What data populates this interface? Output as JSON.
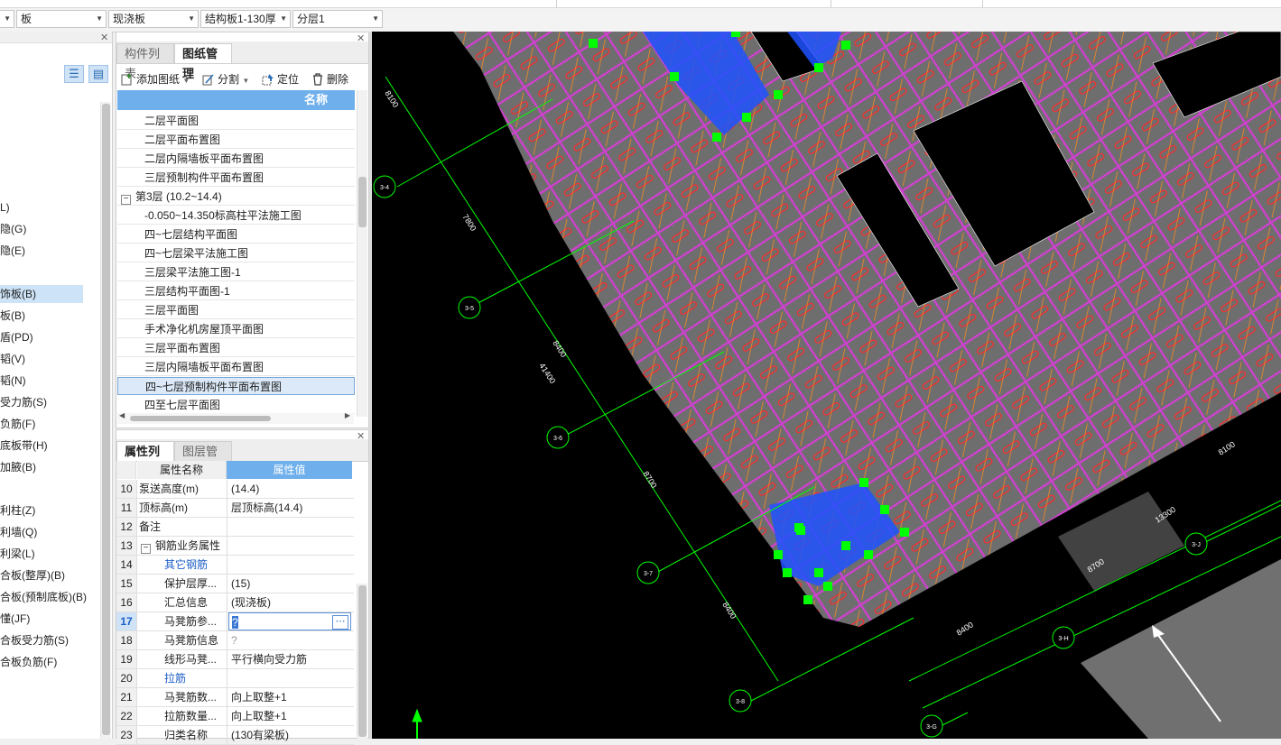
{
  "toolbar": {
    "combo_board": "板",
    "combo_type": "现浇板",
    "combo_spec": "结构板1-130厚",
    "combo_floor": "分层1"
  },
  "nav": {
    "items": [
      {
        "label": "L)"
      },
      {
        "label": "隐(G)"
      },
      {
        "label": "隐(E)"
      },
      {
        "label": "饰板(B)",
        "selected": true
      },
      {
        "label": "板(B)"
      },
      {
        "label": "盾(PD)"
      },
      {
        "label": "韬(V)"
      },
      {
        "label": "韬(N)"
      },
      {
        "label": "受力筋(S)"
      },
      {
        "label": "负筋(F)"
      },
      {
        "label": "底板带(H)"
      },
      {
        "label": "加腋(B)"
      },
      {
        "label": "利柱(Z)"
      },
      {
        "label": "利墙(Q)"
      },
      {
        "label": "利梁(L)"
      },
      {
        "label": "合板(整厚)(B)"
      },
      {
        "label": "合板(预制底板)(B)"
      },
      {
        "label": "懂(JF)"
      },
      {
        "label": "合板受力筋(S)"
      },
      {
        "label": "合板负筋(F)"
      }
    ]
  },
  "drawing_panel": {
    "tab_component_list": "构件列表",
    "tab_drawing_mgmt": "图纸管理",
    "btn_add": "添加图纸",
    "btn_split": "分割",
    "btn_locate": "定位",
    "btn_delete": "删除",
    "col_name": "名称",
    "rows": [
      {
        "label": "二层平面图",
        "indent": true
      },
      {
        "label": "二层平面布置图",
        "indent": true
      },
      {
        "label": "二层内隔墙板平面布置图",
        "indent": true
      },
      {
        "label": "三层预制构件平面布置图",
        "indent": true
      },
      {
        "label": "第3层 (10.2~14.4)",
        "group": true
      },
      {
        "label": "-0.050~14.350标高柱平法施工图",
        "indent": true
      },
      {
        "label": "四~七层结构平面图",
        "indent": true
      },
      {
        "label": "四~七层梁平法施工图",
        "indent": true
      },
      {
        "label": "三层梁平法施工图-1",
        "indent": true
      },
      {
        "label": "三层结构平面图-1",
        "indent": true
      },
      {
        "label": "三层平面图",
        "indent": true
      },
      {
        "label": "手术净化机房屋顶平面图",
        "indent": true
      },
      {
        "label": "三层平面布置图",
        "indent": true
      },
      {
        "label": "三层内隔墙板平面布置图",
        "indent": true
      },
      {
        "label": "四~七层预制构件平面布置图",
        "indent": true,
        "selected": true
      },
      {
        "label": "四至七层平面图",
        "indent": true
      }
    ]
  },
  "prop_panel": {
    "tab_props": "属性列表",
    "tab_layers": "图层管理",
    "col_name": "属性名称",
    "col_value": "属性值",
    "rows": [
      {
        "num": "10",
        "name": "泵送高度(m)",
        "value": "(14.4)"
      },
      {
        "num": "11",
        "name": "顶标高(m)",
        "value": "层顶标高(14.4)"
      },
      {
        "num": "12",
        "name": "备注",
        "value": ""
      },
      {
        "num": "13",
        "name": "钢筋业务属性",
        "value": "",
        "group": true
      },
      {
        "num": "14",
        "name": "其它钢筋",
        "value": "",
        "blue": true
      },
      {
        "num": "15",
        "name": "保护层厚...",
        "value": "(15)"
      },
      {
        "num": "16",
        "name": "汇总信息",
        "value": "(现浇板)"
      },
      {
        "num": "17",
        "name": "马凳筋参...",
        "value": "?",
        "editing": true
      },
      {
        "num": "18",
        "name": "马凳筋信息",
        "value": "?",
        "grey": true
      },
      {
        "num": "19",
        "name": "线形马凳...",
        "value": "平行横向受力筋"
      },
      {
        "num": "20",
        "name": "拉筋",
        "value": "",
        "blue": true
      },
      {
        "num": "21",
        "name": "马凳筋数...",
        "value": "向上取整+1"
      },
      {
        "num": "22",
        "name": "拉筋数量...",
        "value": "向上取整+1"
      },
      {
        "num": "23",
        "name": "归类名称",
        "value": "(130有梁板)"
      }
    ]
  },
  "canvas": {
    "axis_labels": [
      "3-4",
      "3-5",
      "3-6",
      "3-7",
      "3-8",
      "3-G",
      "3-H",
      "3-J"
    ],
    "dims": [
      "8100",
      "7800",
      "8400",
      "41400",
      "8700",
      "8400",
      "8400",
      "8700",
      "13300",
      "8100"
    ],
    "colors": {
      "background": "#000000",
      "slab": "#6e6e6e",
      "grid_line": "#00ff00",
      "selected_slab": "#1f52ff",
      "rebar": "#ff2020",
      "outline": "#cc33cc"
    }
  }
}
